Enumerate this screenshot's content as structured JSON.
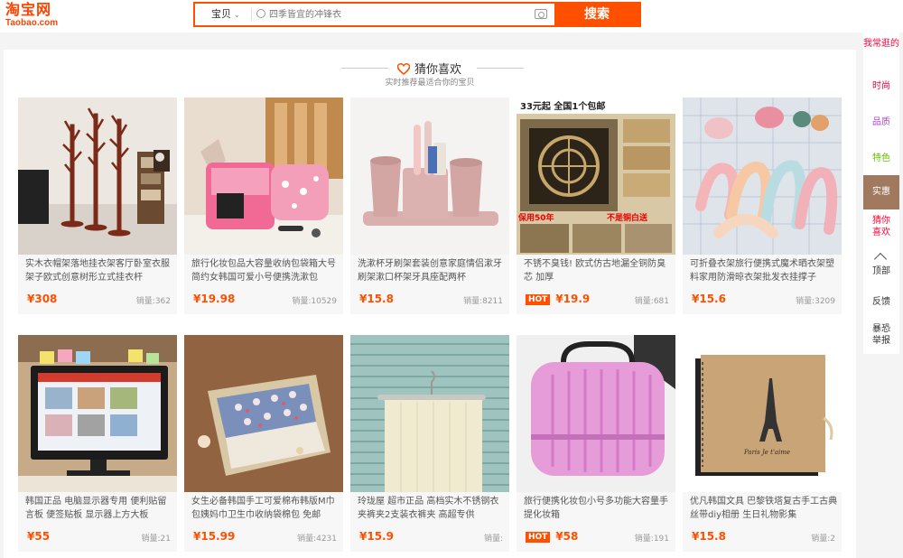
{
  "header": {
    "logo_main": "淘宝网",
    "logo_sub": "Taobao.com",
    "search_category": "宝贝",
    "search_placeholder": "四季皆宜的冲锋衣",
    "search_button": "搜索"
  },
  "guess": {
    "title": "猜你喜欢",
    "subtitle": "实时推荐最适合你的宝贝"
  },
  "products": [
    {
      "title": "实木衣帽架落地挂衣架客厅卧室衣服架子欧式创意树形立式挂衣杆",
      "price": "¥308",
      "sales": "销量:362",
      "hot": ""
    },
    {
      "title": "旅行化妆包品大容量收纳包袋箱大号简约女韩国可爱小号便携洗漱包",
      "price": "¥19.98",
      "sales": "销量:10529",
      "hot": ""
    },
    {
      "title": "洗漱杯牙刷架套装创意家庭情侣漱牙刷架漱口杯架牙具座配两杯",
      "price": "¥15.8",
      "sales": "销量:8211",
      "hot": ""
    },
    {
      "title": "不锈不臭钱! 欧式仿古地漏全铜防臭芯 加厚",
      "price": "¥19.9",
      "sales": "销量:681",
      "hot": "HOT"
    },
    {
      "title": "可折叠衣架旅行便携式魔术晒衣架塑料家用防滑晾衣架批发衣挂撑子",
      "price": "¥15.6",
      "sales": "销量:3209",
      "hot": ""
    },
    {
      "title": "韩国正品 电脑显示器专用 便利贴留言板 便签贴板 显示器上方大板",
      "price": "¥55",
      "sales": "销量:21",
      "hot": ""
    },
    {
      "title": "女生必备韩国手工可爱棉布韩版M巾包姨妈巾卫生巾收纳袋棉包 免邮",
      "price": "¥15.99",
      "sales": "销量:4231",
      "hot": ""
    },
    {
      "title": "玲珑屋 超市正品 高档实木不锈钢衣夹裤夹2支装衣裤夹 高超专供",
      "price": "¥15.9",
      "sales": "销量:",
      "hot": ""
    },
    {
      "title": "旅行便携化妆包小号多功能大容量手提化妆箱",
      "price": "¥58",
      "sales": "销量:191",
      "hot": "HOT"
    },
    {
      "title": "优凡韩国文具 巴黎铁塔复古手工古典丝带diy相册 生日礼物影集",
      "price": "¥15.8",
      "sales": "销量:2",
      "hot": ""
    }
  ],
  "image_text": {
    "drain_top": "33元起  全国1个包邮",
    "drain_warranty": "保用50年",
    "drain_copper": "不是铜白送",
    "album_caption": "Paris Je t'aime"
  },
  "sidebar": {
    "items": [
      "我常逛的",
      "时尚",
      "品质",
      "特色",
      "实惠",
      "猜你喜欢",
      "顶部",
      "反馈",
      "暴恐举报"
    ]
  },
  "colors": {
    "brand": "#ff5000",
    "price": "#ff5000",
    "sidebar_active": "#a1795f",
    "sidebar_red": "#ff0036",
    "sidebar_green": "#6cbf00"
  }
}
